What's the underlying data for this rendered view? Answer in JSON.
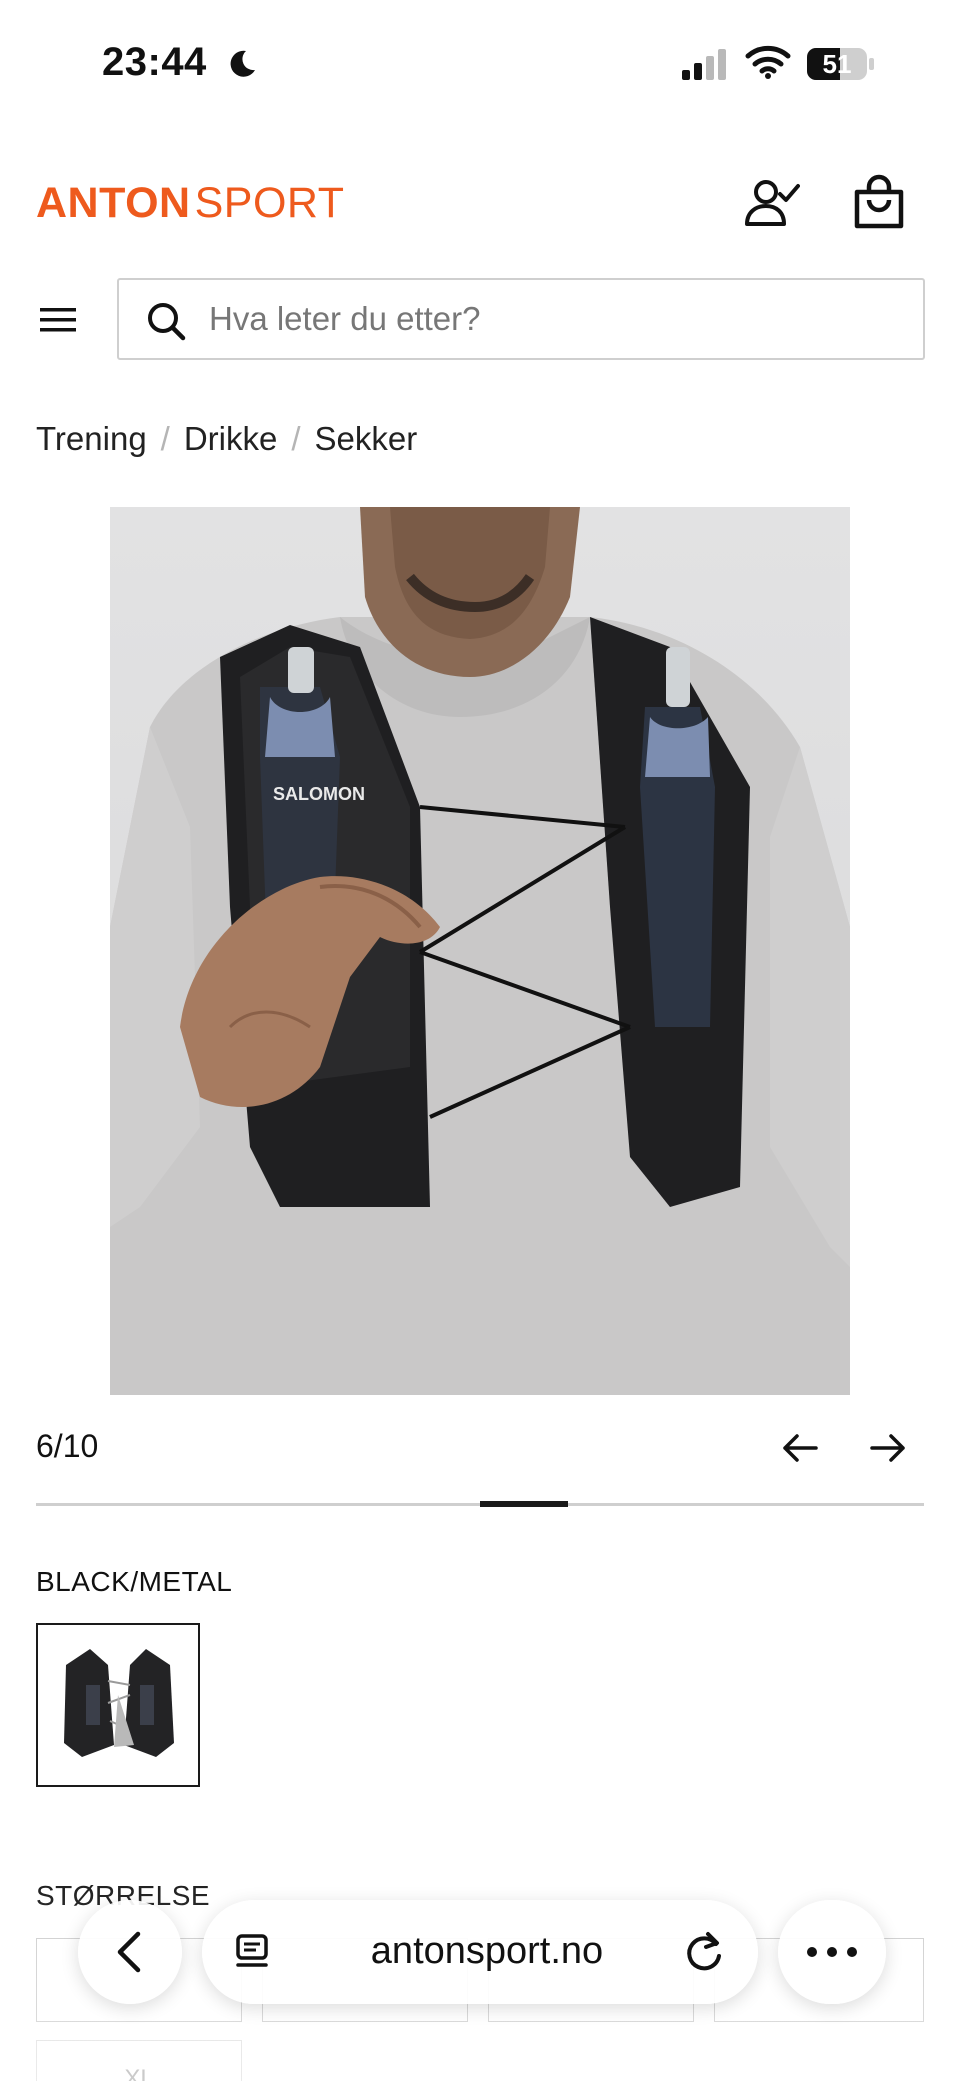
{
  "status_bar": {
    "time": "23:44",
    "battery": "51"
  },
  "header": {
    "logo_bold": "ANTON",
    "logo_light": "SPORT"
  },
  "search": {
    "placeholder": "Hva leter du etter?"
  },
  "breadcrumb": {
    "items": [
      "Trening",
      "Drikke",
      "Sekker"
    ],
    "separator": "/"
  },
  "carousel": {
    "counter": "6/10",
    "current": 6,
    "total": 10
  },
  "product": {
    "color_label": "BLACK/METAL",
    "vest_brand": "SALOMON"
  },
  "sizes": {
    "label": "STØRRELSE",
    "options": [
      "XL"
    ]
  },
  "browser": {
    "url": "antonsport.no"
  },
  "colors": {
    "brand": "#ee5a1d",
    "text": "#1a1a1a",
    "border": "#cfcfcf"
  },
  "icons": {
    "moon": "moon-icon",
    "signal": "signal-icon",
    "wifi": "wifi-icon",
    "battery": "battery-icon",
    "account": "account-icon",
    "bag": "shopping-bag-icon",
    "menu": "menu-icon",
    "search": "search-icon",
    "arrow_left": "arrow-left-icon",
    "arrow_right": "arrow-right-icon",
    "back": "chevron-left-icon",
    "tabs": "tabs-icon",
    "reload": "reload-icon",
    "more": "more-icon"
  }
}
